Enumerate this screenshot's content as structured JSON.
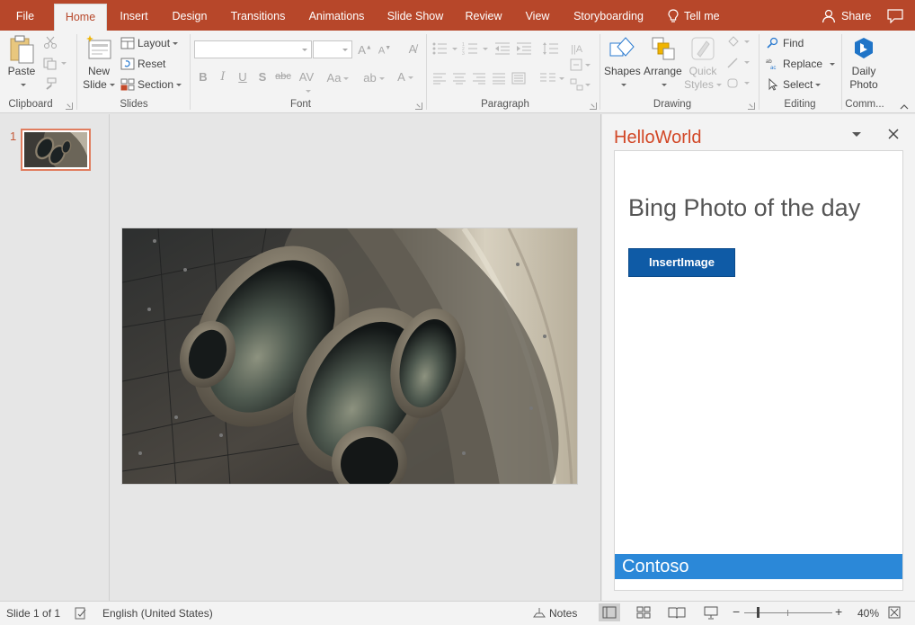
{
  "tabs": {
    "file": "File",
    "home": "Home",
    "insert": "Insert",
    "design": "Design",
    "transitions": "Transitions",
    "animations": "Animations",
    "slideshow": "Slide Show",
    "review": "Review",
    "view": "View",
    "storyboarding": "Storyboarding",
    "tellme": "Tell me",
    "share": "Share"
  },
  "ribbon": {
    "clipboard": {
      "label": "Clipboard",
      "paste": "Paste"
    },
    "slides": {
      "label": "Slides",
      "new_line1": "New",
      "new_line2": "Slide",
      "layout": "Layout",
      "reset": "Reset",
      "section": "Section"
    },
    "font": {
      "label": "Font",
      "font_name": "",
      "font_size": ""
    },
    "paragraph": {
      "label": "Paragraph"
    },
    "drawing": {
      "label": "Drawing",
      "shapes": "Shapes",
      "arrange": "Arrange",
      "quick_line1": "Quick",
      "quick_line2": "Styles"
    },
    "editing": {
      "label": "Editing",
      "find": "Find",
      "replace": "Replace",
      "select": "Select"
    },
    "addin": {
      "label": "Comm...",
      "line1": "Daily",
      "line2": "Photo"
    }
  },
  "thumbs": {
    "slide_number": "1"
  },
  "taskpane": {
    "title": "HelloWorld",
    "heading": "Bing Photo of the day",
    "button": "InsertImage",
    "footer": "Contoso"
  },
  "status": {
    "slide": "Slide 1 of 1",
    "language": "English (United States)",
    "notes": "Notes",
    "zoom": "40%"
  },
  "colors": {
    "accent": "#b7472a",
    "pane_title": "#d24726",
    "insert_button": "#0f5ba6",
    "footer": "#2b88d8"
  }
}
